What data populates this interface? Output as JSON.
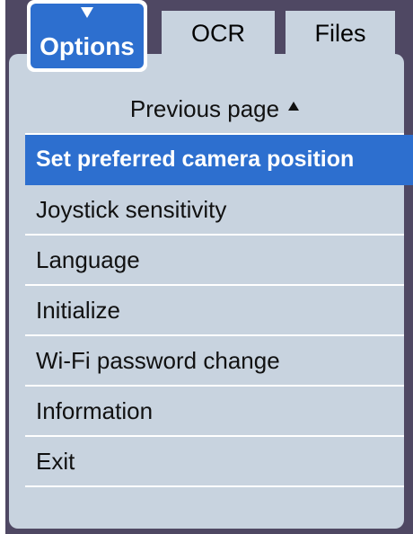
{
  "tabs": {
    "active": {
      "label": "Options"
    },
    "ocr": {
      "label": "OCR"
    },
    "files": {
      "label": "Files"
    }
  },
  "menu": {
    "previous_page": "Previous page",
    "items": [
      {
        "label": "Set preferred camera position",
        "selected": true
      },
      {
        "label": "Joystick sensitivity"
      },
      {
        "label": "Language"
      },
      {
        "label": "Initialize"
      },
      {
        "label": "Wi-Fi password change"
      },
      {
        "label": "Information"
      },
      {
        "label": "Exit"
      }
    ]
  },
  "colors": {
    "frame": "#4f4863",
    "panel": "#c8d3df",
    "accent": "#2d6fcf",
    "divider": "#ffffff"
  },
  "icons": {
    "active_tab_indicator": "caret-down-icon",
    "previous_page_indicator": "triangle-up-icon"
  }
}
